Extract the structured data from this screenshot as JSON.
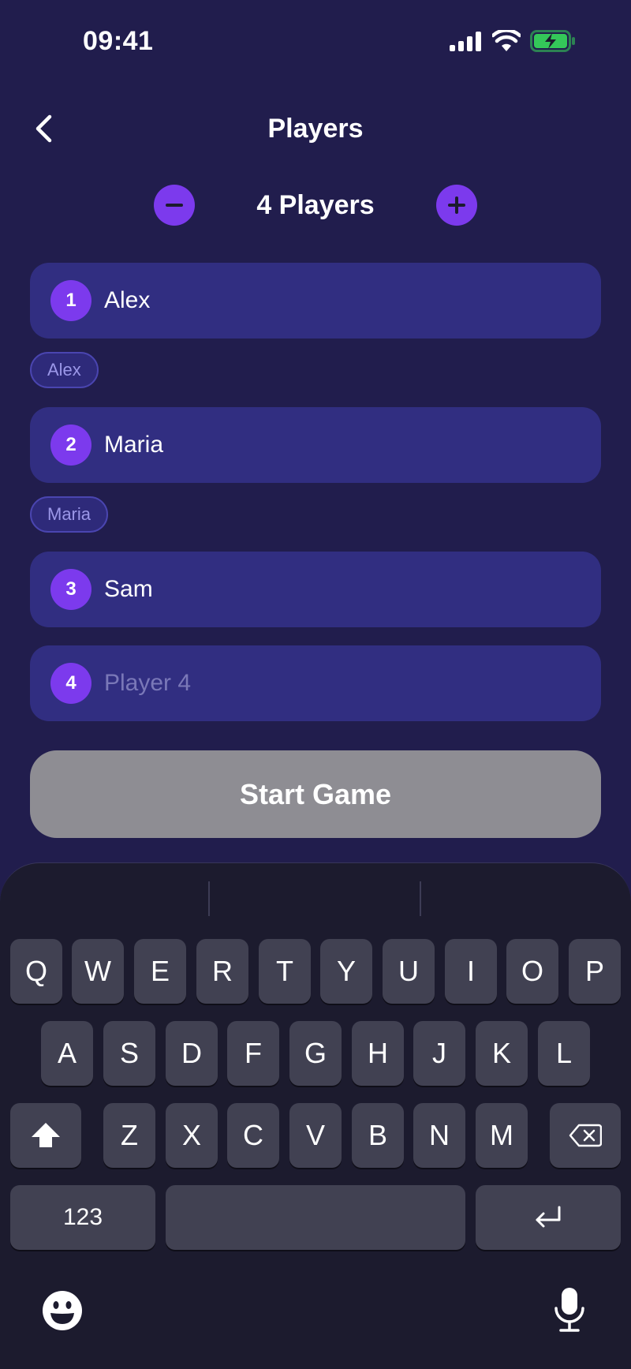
{
  "status": {
    "time": "09:41"
  },
  "header": {
    "title": "Players"
  },
  "stepper": {
    "count_label": "4 Players"
  },
  "players": [
    {
      "number": "1",
      "name": "Alex",
      "suggestion": "Alex"
    },
    {
      "number": "2",
      "name": "Maria",
      "suggestion": "Maria"
    },
    {
      "number": "3",
      "name": "Sam"
    },
    {
      "number": "4",
      "placeholder": "Player 4"
    }
  ],
  "start_button": {
    "label": "Start Game"
  },
  "keyboard": {
    "row1": [
      "Q",
      "W",
      "E",
      "R",
      "T",
      "Y",
      "U",
      "I",
      "O",
      "P"
    ],
    "row2": [
      "A",
      "S",
      "D",
      "F",
      "G",
      "H",
      "J",
      "K",
      "L"
    ],
    "row3": [
      "Z",
      "X",
      "C",
      "V",
      "B",
      "N",
      "M"
    ],
    "numbers_key": "123"
  },
  "colors": {
    "background": "#211d4d",
    "field": "#312e81",
    "accent": "#7c3aed",
    "button_disabled": "#8e8d93",
    "keyboard": "#1c1b2e",
    "key": "#414152",
    "battery": "#34c759"
  },
  "icons": [
    "back-chevron-icon",
    "minus-icon",
    "plus-icon",
    "signal-icon",
    "wifi-icon",
    "battery-charging-icon",
    "shift-icon",
    "backspace-icon",
    "return-icon",
    "emoji-icon",
    "microphone-icon"
  ]
}
